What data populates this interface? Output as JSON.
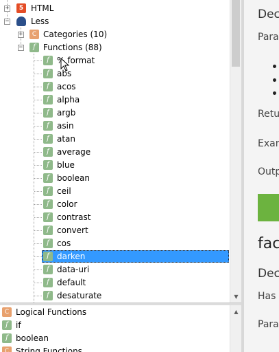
{
  "tree": {
    "root_items": [
      {
        "label": "HTML",
        "icon": "html5-icon"
      },
      {
        "label": "Less",
        "icon": "less-icon"
      }
    ],
    "less_children": [
      {
        "label": "Categories (10)",
        "icon": "category-icon"
      },
      {
        "label": "Functions (88)",
        "icon": "function-icon"
      }
    ],
    "functions": [
      "% format",
      "abs",
      "acos",
      "alpha",
      "argb",
      "asin",
      "atan",
      "average",
      "blue",
      "boolean",
      "ceil",
      "color",
      "contrast",
      "convert",
      "cos",
      "darken",
      "data-uri",
      "default",
      "desaturate"
    ],
    "selected": "darken",
    "expander_plus": "+",
    "expander_minus": "−"
  },
  "bottom_list": {
    "items": [
      {
        "label": "Logical Functions",
        "icon": "category-icon"
      },
      {
        "label": "if",
        "icon": "function-icon"
      },
      {
        "label": "boolean",
        "icon": "function-icon"
      },
      {
        "label": "String Functions",
        "icon": "category-icon"
      }
    ]
  },
  "detail": {
    "lines": [
      "Dec",
      "Para",
      "Retu",
      "Exam",
      "Outp",
      "fac",
      "Dec",
      "Has",
      "Para"
    ]
  },
  "icons": {
    "function_glyph": "f",
    "category_glyph": "C",
    "html5_glyph": "5",
    "scroll_up": "▲",
    "scroll_down": "▼"
  },
  "colors": {
    "selection": "#3399ff",
    "function_icon": "#8fb98a",
    "category_icon": "#e8a16e",
    "accent_green": "#6cb33f"
  }
}
